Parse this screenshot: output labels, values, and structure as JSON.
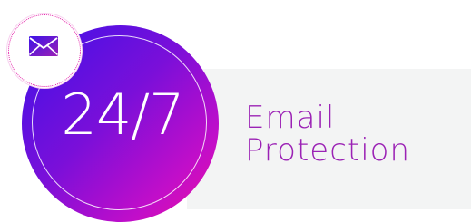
{
  "graphic": {
    "badge_text": "24/7",
    "label_lines": [
      "Email",
      "Protection"
    ],
    "icon": "mail-icon",
    "colors": {
      "accent_start": "#3d12e8",
      "accent_end": "#ec0f9e",
      "label": "#9b22b5",
      "panel": "#f3f4f4"
    }
  }
}
